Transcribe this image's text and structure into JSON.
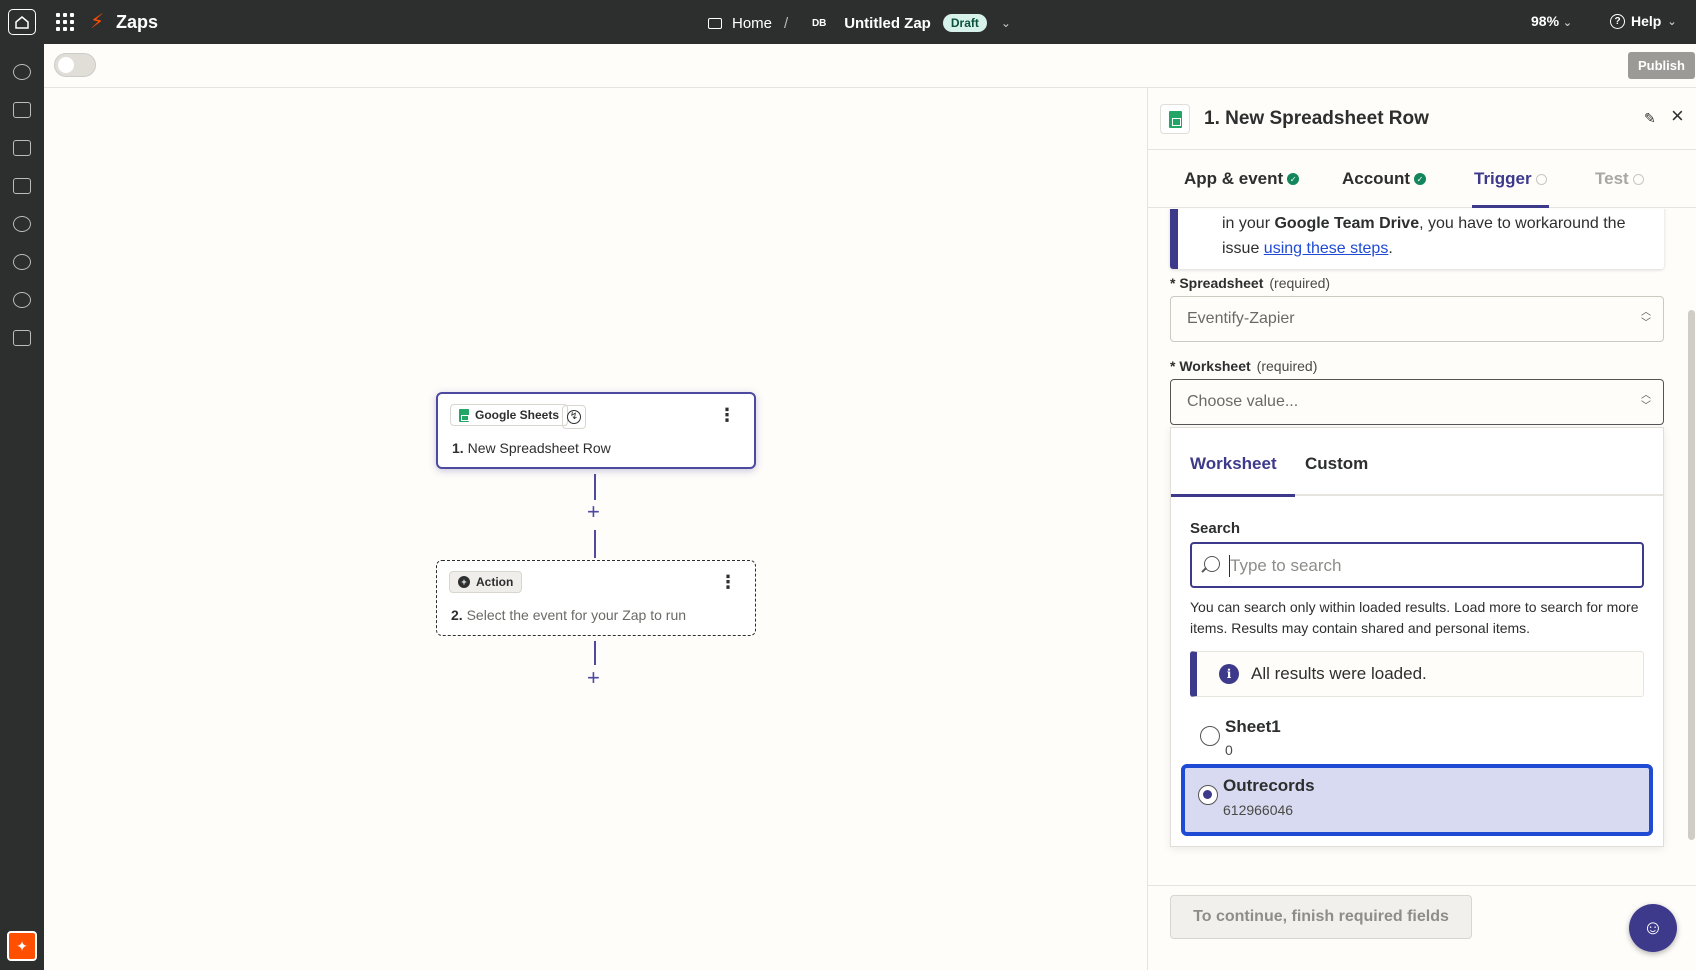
{
  "topbar": {
    "brand": "Zaps",
    "breadcrumb_home": "Home",
    "breadcrumb_sep": "/",
    "avatar_initials": "DB",
    "zap_title": "Untitled Zap",
    "status_badge": "Draft",
    "zoom": "98%",
    "help_label": "Help"
  },
  "toolbar": {
    "publish_label": "Publish",
    "toggle_on": false
  },
  "canvas": {
    "trigger_node": {
      "app_name": "Google Sheets",
      "step_number": "1.",
      "title": "New Spreadsheet Row"
    },
    "action_node": {
      "chip_label": "Action",
      "step_number": "2.",
      "title": "Select the event for your Zap to run"
    }
  },
  "panel": {
    "title": "1. New Spreadsheet Row",
    "tabs": [
      {
        "label": "App & event",
        "state": "complete"
      },
      {
        "label": "Account",
        "state": "complete"
      },
      {
        "label": "Trigger",
        "state": "active"
      },
      {
        "label": "Test",
        "state": "disabled"
      }
    ],
    "notice": {
      "text_before": "in your ",
      "bold": "Google Team Drive",
      "text_middle": ", you have to workaround the issue ",
      "link": "using these steps",
      "text_after": "."
    },
    "spreadsheet_field": {
      "label": "Spreadsheet",
      "required": "(required)",
      "value": "Eventify-Zapier"
    },
    "worksheet_field": {
      "label": "Worksheet",
      "required": "(required)",
      "placeholder": "Choose value..."
    },
    "dropdown": {
      "tabs": [
        "Worksheet",
        "Custom"
      ],
      "search_label": "Search",
      "search_placeholder": "Type to search",
      "help_text": "You can search only within loaded results. Load more to search for more items. Results may contain shared and personal items.",
      "info_text": "All results were loaded.",
      "options": [
        {
          "name": "Sheet1",
          "id": "0",
          "selected": false
        },
        {
          "name": "Outrecords",
          "id": "612966046",
          "selected": true
        }
      ]
    },
    "footer_button": "To continue, finish required fields"
  },
  "colors": {
    "accent": "#3d3a8c",
    "brand_orange": "#ff4f00",
    "sheets_green": "#23a566",
    "link_blue": "#1f4ad4"
  }
}
